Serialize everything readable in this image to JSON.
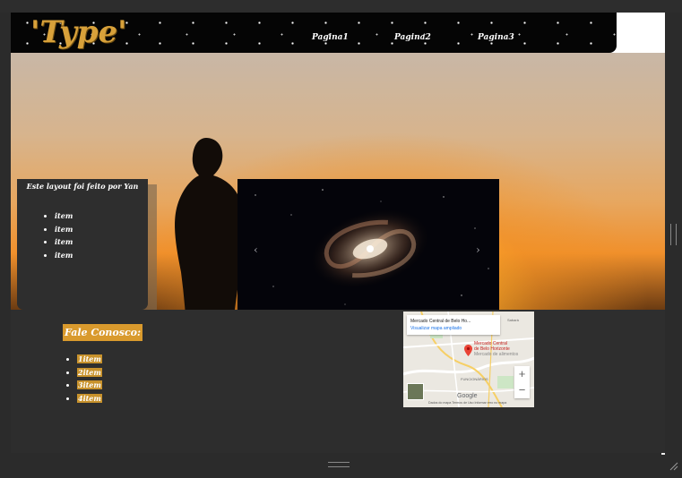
{
  "header": {
    "logo": "'Type'",
    "nav": [
      "Pagina1",
      "Pagina2",
      "Pagina3"
    ]
  },
  "sidebar": {
    "title": "Este layout foi feito por Yan",
    "items": [
      "item",
      "item",
      "item",
      "item"
    ]
  },
  "carousel": {
    "prev_icon": "chevron-left-icon",
    "next_icon": "chevron-right-icon"
  },
  "footer": {
    "contact_title": "Fale Conosco:",
    "contact_items": [
      "1item",
      "2item",
      "3item",
      "4item"
    ]
  },
  "map": {
    "place_title": "Mercado Central de Belo Ho...",
    "view_larger": "Visualizar mapa ampliado",
    "pin_label_1": "Mercado Central",
    "pin_label_2": "de Belo Horizonte",
    "pin_label_3": "Mercado de alimentos",
    "district": "FUNCIONÁRIOS",
    "town": "Sabará",
    "zoom_in": "+",
    "zoom_out": "−",
    "google": "Google",
    "attribution": "Dados do mapa   Termos de Uso   Informar erro no mapa"
  },
  "colors": {
    "accent": "#d99a2d",
    "panel": "#2e2e2e",
    "header": "#050505"
  }
}
